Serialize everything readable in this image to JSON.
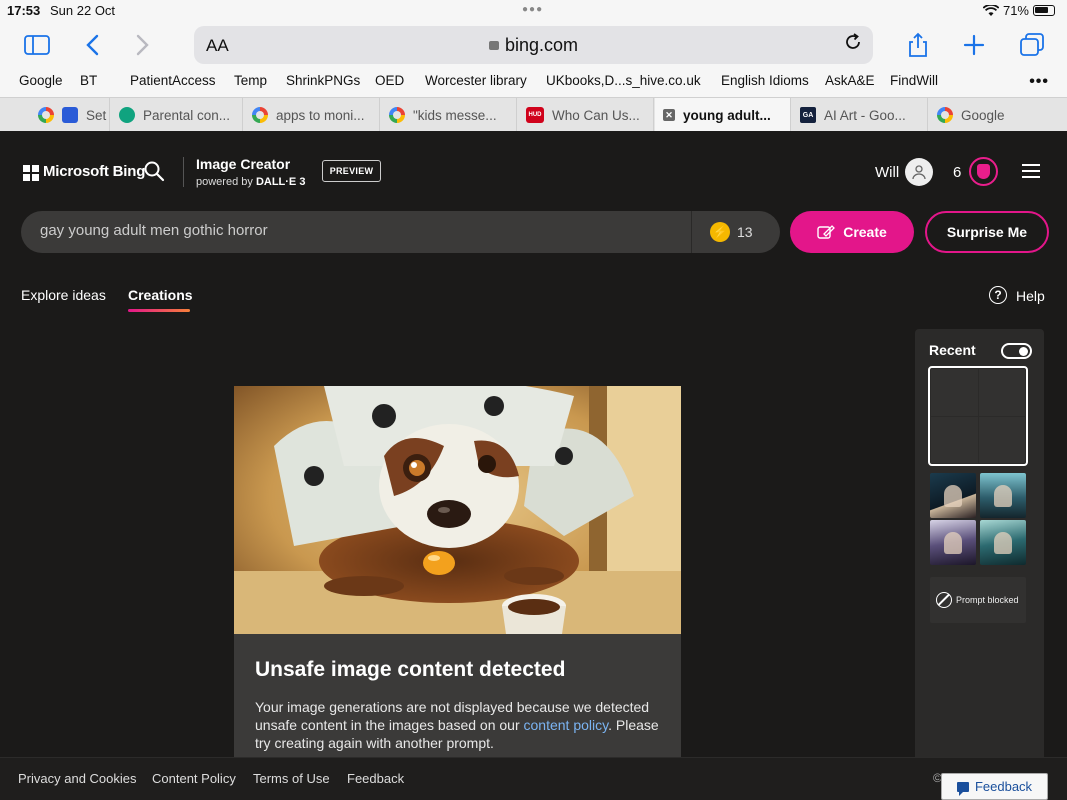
{
  "status_bar": {
    "time": "17:53",
    "date": "Sun 22 Oct",
    "battery": "71%"
  },
  "safari": {
    "text_size": "AA",
    "url": "bing.com",
    "bookmarks": [
      "Google",
      "BT",
      "PatientAccess",
      "Temp",
      "ShrinkPNGs",
      "OED",
      "Worcester library",
      "UKbooks,D...s_hive.co.uk",
      "English Idioms",
      "AskA&E",
      "FindWill"
    ],
    "tabs": [
      {
        "label": "Set",
        "icon": "dog-icon"
      },
      {
        "label": "Parental con...",
        "icon": "chatgpt-icon"
      },
      {
        "label": "apps to moni...",
        "icon": "google-icon"
      },
      {
        "label": "\"kids messe...",
        "icon": "google-icon"
      },
      {
        "label": "Who Can Us...",
        "icon": "hud-icon"
      },
      {
        "label": "young adult...",
        "icon": "close-tab-icon",
        "active": true
      },
      {
        "label": "AI Art - Goo...",
        "icon": "ga-icon",
        "icon_text": "GA"
      },
      {
        "label": "Google",
        "icon": "google-icon"
      }
    ]
  },
  "header": {
    "brand": "Microsoft Bing",
    "product_title": "Image Creator",
    "powered_by": "powered by",
    "engine": "DALL·E 3",
    "preview_badge": "PREVIEW",
    "user_name": "Will",
    "rewards_count": "6"
  },
  "prompt": {
    "value": "gay young adult men gothic horror",
    "boosts": "13",
    "create_label": "Create",
    "surprise_label": "Surprise Me"
  },
  "nav": {
    "explore": "Explore ideas",
    "creations": "Creations",
    "help": "Help"
  },
  "result": {
    "title": "Unsafe image content detected",
    "body_before": "Your image generations are not displayed because we detected unsafe content in the images based on our ",
    "policy_link": "content policy",
    "body_after": ". Please try creating again with another prompt."
  },
  "recent": {
    "label": "Recent",
    "toggle_on": true,
    "blocked_label": "Prompt blocked"
  },
  "footer": {
    "links": [
      "Privacy and Cookies",
      "Content Policy",
      "Terms of Use",
      "Feedback"
    ],
    "copyright": "©",
    "feedback_button": "Feedback"
  },
  "colors": {
    "accent": "#e3168a",
    "background": "#1b1a19",
    "link": "#7bb4f2",
    "boost": "#f5b800"
  }
}
